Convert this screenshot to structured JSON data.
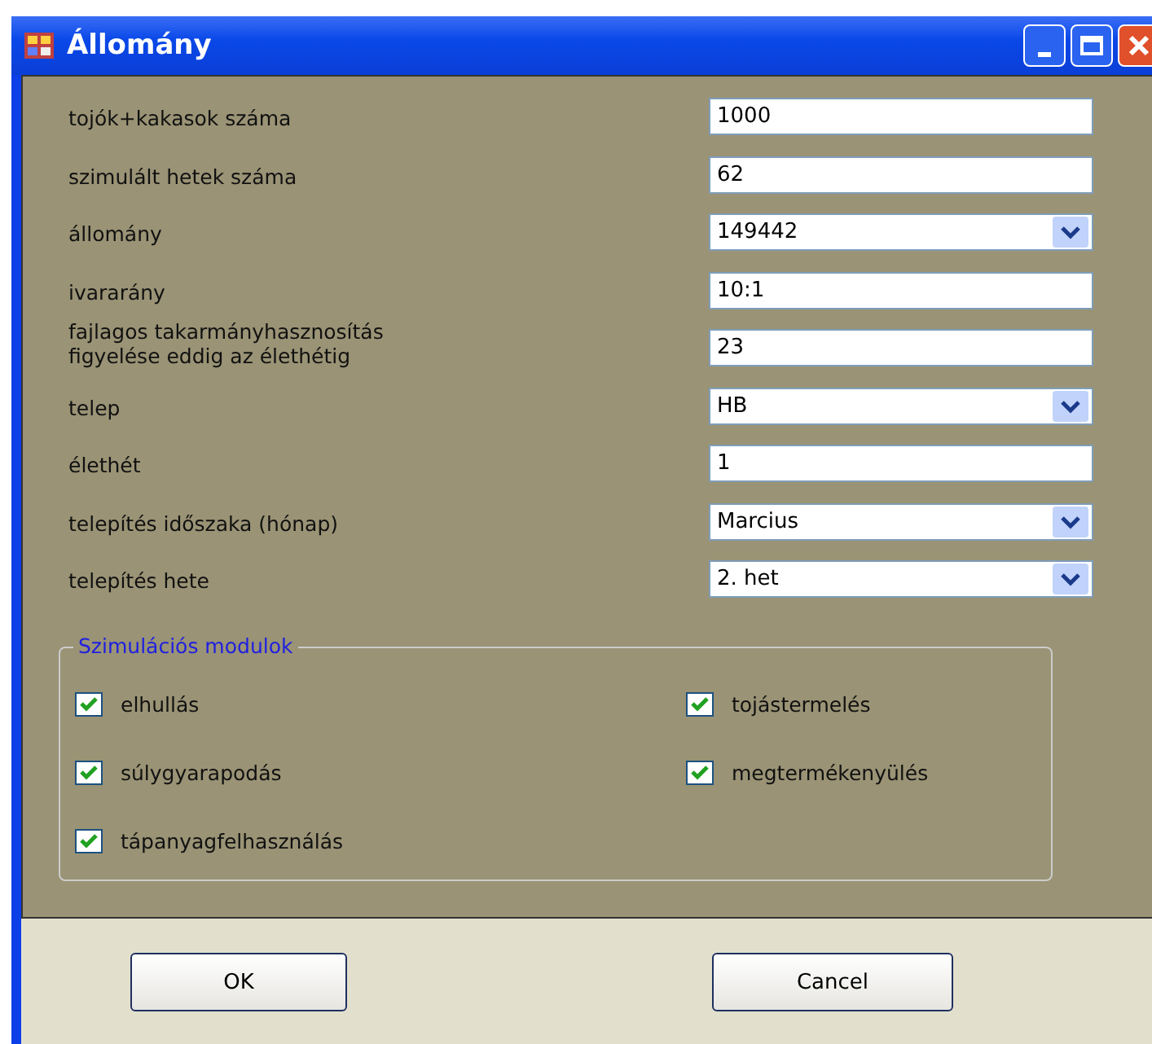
{
  "window": {
    "title": "Állomány"
  },
  "fields": [
    {
      "label": "tojók+kakasok száma",
      "kind": "text",
      "value": "1000"
    },
    {
      "label": "szimulált hetek száma",
      "kind": "text",
      "value": "62"
    },
    {
      "label": "állomány",
      "kind": "combo",
      "value": "149442"
    },
    {
      "label": "ivararány",
      "kind": "text",
      "value": "10:1"
    },
    {
      "label": "fajlagos takarmányhasznosítás\nfigyelése eddig az élethétig",
      "kind": "text",
      "value": "23"
    },
    {
      "label": "telep",
      "kind": "combo",
      "value": "HB"
    },
    {
      "label": "élethét",
      "kind": "text",
      "value": "1"
    },
    {
      "label": "telepítés időszaka (hónap)",
      "kind": "combo",
      "value": "Marcius"
    },
    {
      "label": "telepítés hete",
      "kind": "combo",
      "value": "2. het"
    }
  ],
  "modules": {
    "title": "Szimulációs modulok",
    "items": [
      {
        "label": "elhullás",
        "checked": true
      },
      {
        "label": "tojástermelés",
        "checked": true
      },
      {
        "label": "súlygyarapodás",
        "checked": true
      },
      {
        "label": "megtermékenyülés",
        "checked": true
      },
      {
        "label": "tápanyagfelhasználás",
        "checked": true
      }
    ]
  },
  "buttons": [
    "OK",
    "Cancel"
  ]
}
